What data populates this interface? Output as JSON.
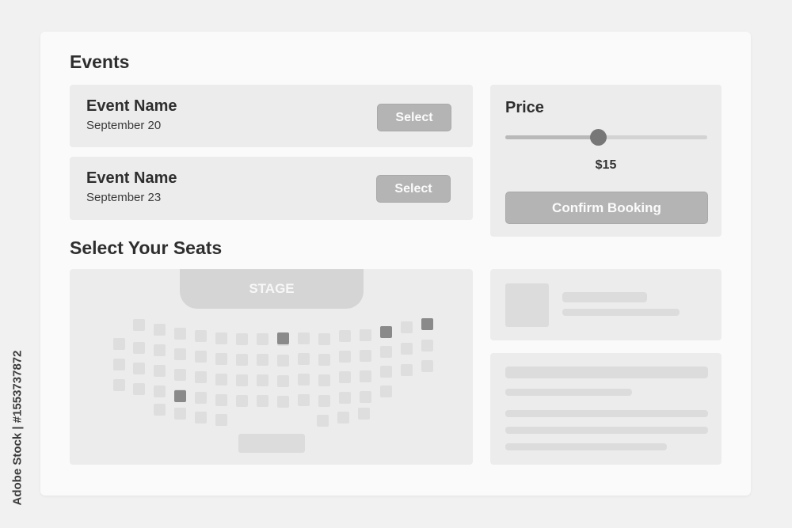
{
  "events_section": {
    "title": "Events"
  },
  "events": [
    {
      "name": "Event Name",
      "date": "September 20",
      "button_label": "Select"
    },
    {
      "name": "Event Name",
      "date": "September 23",
      "button_label": "Select"
    }
  ],
  "price_panel": {
    "label": "Price",
    "value_text": "$15",
    "slider_level": 0.46,
    "confirm_label": "Confirm Booking"
  },
  "seats_section": {
    "title": "Select Your Seats",
    "stage_label": "STAGE"
  },
  "seat_selection": {
    "selected_count": 4
  },
  "watermark": "Adobe Stock | #1553737872",
  "colors": {
    "background": "#f1f1f1",
    "panel": "#ececec",
    "button": "#b4b4b4",
    "seat": "#dedede",
    "seat_selected": "#8a8a8a"
  }
}
